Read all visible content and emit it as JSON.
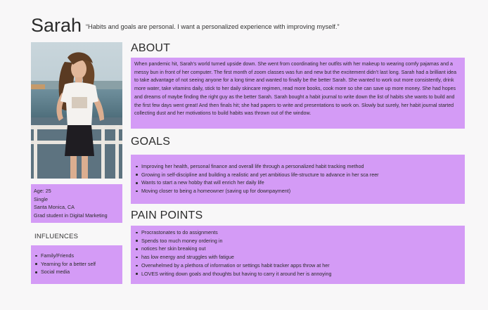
{
  "persona": {
    "name": "Sarah",
    "quote": "“Habits and goals are personal. I want a personalized experience with improving myself.”"
  },
  "facts": [
    "Age: 25",
    "Single",
    "Santa Monica, CA",
    "Grad student in Digital Marketing"
  ],
  "influences": {
    "title": "INFLUENCES",
    "items": [
      "Family/Friends",
      "Yearning for a better self",
      "Social media"
    ]
  },
  "about": {
    "title": "ABOUT",
    "text": "When pandemic hit, Sarah’s world turned upside down. She went from coordinating her outfits with her makeup to wearing comfy pajamas and a messy bun in front of her computer. The first month of zoom classes was fun and new but the excitement didn’t last long. Sarah had a brilliant idea to take advantage of not seeing anyone for a long time and wanted to finally be the better Sarah. She wanted to work out more consistently, drink more water, take vitamins daily, stick to her daily skincare regimen, read more books, cook more so she can save up more money. She had hopes and dreams of maybe finding the right guy as the better Sarah. Sarah bought a habit journal to write down the list of habits she wants to build and the first few days went great! And then finals hit; she had papers to write and presentations to work on.  Slowly but surely, her habit journal started collecting dust and her motivations to build habits was thrown out of the window."
  },
  "goals": {
    "title": "GOALS",
    "items": [
      "Improving her health, personal finance and overall life through a personalized habit tracking method",
      "Growing in self-discipline and building a realistic and yet ambitious life-structure to advance in her sca reer",
      "Wants to start a new hobby that will enrich her daily life",
      "Moving closer to being a homeowner (saving up for downpayment)"
    ]
  },
  "pain_points": {
    "title": "PAIN POINTS",
    "items": [
      "Procrastonates to do assignments",
      "Spends too much money ordering in",
      "notices her skin breaking out",
      "has low energy and struggles with fatigue",
      "Overwhelmed by a plethora of information or settings habit tracker apps throw at her",
      "LOVES writing down goals and thoughts but having to carry it around her is annoying"
    ]
  },
  "colors": {
    "card": "#d49bf6",
    "background": "#f8f7f8"
  }
}
